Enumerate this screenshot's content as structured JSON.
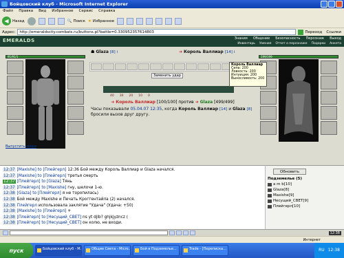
{
  "window": {
    "title": "Бойцовский клуб - Microsoft Internet Explorer"
  },
  "menu": [
    "Файл",
    "Правка",
    "Вид",
    "Избранное",
    "Сервис",
    "Справка"
  ],
  "toolbar": {
    "back": "Назад",
    "search": "Поиск",
    "favorites": "Избранное"
  },
  "address": {
    "label": "Адрес:",
    "url": "http://emeraldscity.combats.ru/buttons.pl?battle=0.330952357614803",
    "go": "Переход",
    "links": "Ссылки"
  },
  "game": {
    "logo": "EMERALDS",
    "nav_top": [
      "Знания",
      "Общение",
      "Безопасность",
      "Персонаж",
      "Выход"
    ],
    "nav_bottom": [
      "Инвентарь",
      "Умения",
      "Отчет о персонаже",
      "Подарки",
      "Анкета"
    ],
    "left_hp": "91/91/1",
    "right_hp": "199/199",
    "details_link": "Выпустить зверя",
    "player": {
      "name": "Glaza",
      "level": "[8]",
      "info": "i"
    },
    "opponent": {
      "name": "Король Валлиар",
      "level": "[14]",
      "info": "i"
    },
    "tooltip": {
      "title": "Король Валлиар",
      "lines": [
        "Сила: 200",
        "Ловкость: 200",
        "Интуиция: 200",
        "Выносливость: 200"
      ]
    },
    "change_button": "Заменить удар",
    "timeline": [
      "40",
      "30",
      "20",
      "10",
      "0"
    ],
    "duel": {
      "a": "Король Валлиар",
      "a_hp": "[100/100]",
      "vs": "против",
      "b": "Glaza",
      "b_hp": "[499/499]"
    },
    "duel_msg_1": "Часы показывали",
    "duel_time": "05.04.07 12:35",
    "duel_msg_2": ", когда",
    "duel_who": "Король Валлиар",
    "duel_lvl": "[14]",
    "duel_msg_3": "и",
    "duel_other": "Glaza",
    "duel_lvl2": "[8]",
    "duel_msg_4": "бросили вызов друг другу."
  },
  "chat": [
    {
      "t": "12:37",
      "who": "[Maxishe]",
      "to": "to [Плейгерл]",
      "text": "12:36 Бой между Король Валлиар и Glaza начался.",
      "hl": false
    },
    {
      "t": "12:37",
      "who": "[Maxishe]",
      "to": "to [Плейгерл]",
      "text": "третья смерть",
      "hl": false
    },
    {
      "t": "12:37",
      "who": "[Плейгерл]",
      "to": "to [Glaza]",
      "text": "Тянь",
      "hl": true
    },
    {
      "t": "12:37",
      "who": "[Плейгерл]",
      "to": "to [Maxishe]",
      "text": "гну, шелочи 1-ю.",
      "hl": false
    },
    {
      "t": "12:38",
      "who": "[Glaza]",
      "to": "to [Плейгерл]",
      "text": "я не торопилась)",
      "hl": false
    },
    {
      "t": "12:38",
      "who": "",
      "to": "",
      "text": "Бой между Maxishe и Печать Кроггентайла (2) начался.",
      "hl": false
    },
    {
      "t": "12:38",
      "who": "Плейгерл",
      "to": "",
      "text": "использовала заклятие \"Удача\" (Удача: +50)",
      "hl": false
    },
    {
      "t": "12:38",
      "who": "[Maxishe]",
      "to": "to [Плейгерл]",
      "text": "+",
      "hl": false
    },
    {
      "t": "12:38",
      "who": "[Плейгерл]",
      "to": "to [Несущий_СВЕТ]",
      "text": "ns yt djlb? ghjkjyzncz (",
      "hl": false
    },
    {
      "t": "12:38",
      "who": "[Плейгерл]",
      "to": "to [Несущий_СВЕТ]",
      "text": "он колю, не входи.",
      "hl": false
    }
  ],
  "online": {
    "refresh": "Обновить",
    "location": "Подземелье (5)",
    "users": [
      "a m b[10]",
      "Glaza[8]",
      "Maxishe[9]",
      "Несущий_СВЕТ[9]",
      "Плейгерл[10]"
    ]
  },
  "statusbar": {
    "left": "",
    "internet": "Интернет"
  },
  "taskbar": {
    "start": "пуск",
    "tasks": [
      "Бойцовский клуб - M...",
      "Общие Света - Micro...",
      "Бой в Подземелье...",
      "Trade - [Переписка..."
    ],
    "lang": "RU",
    "time": "12:38"
  },
  "clock": "12:38"
}
